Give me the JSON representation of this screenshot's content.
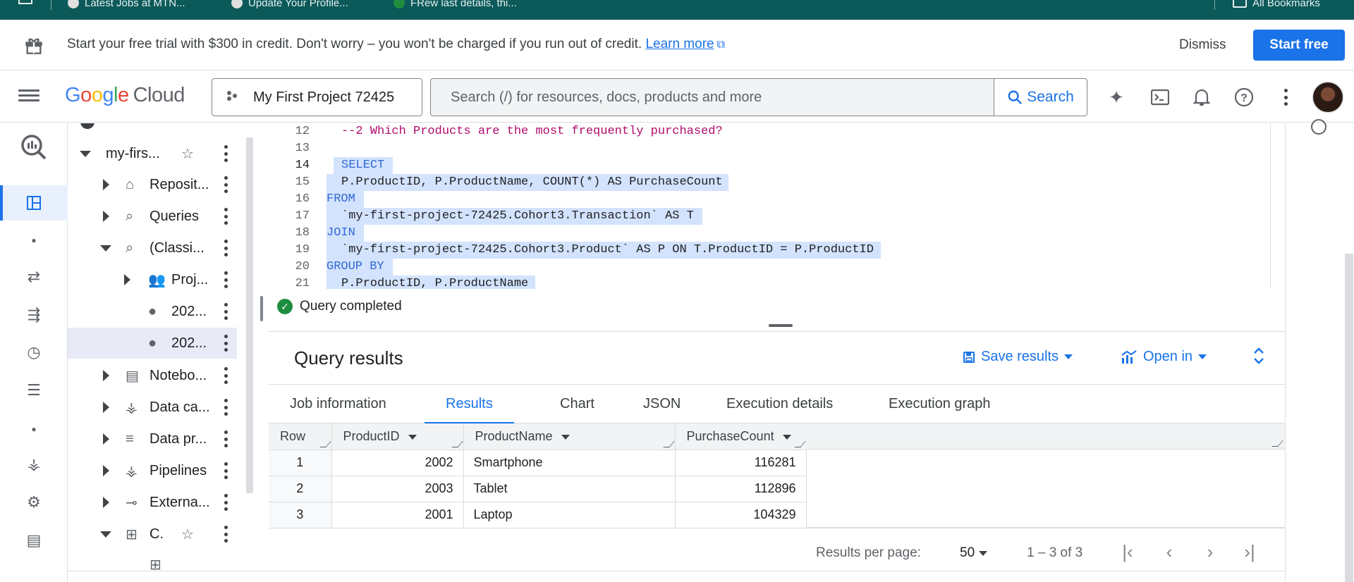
{
  "bookmarks": [
    {
      "label": "Latest Jobs at MTN..."
    },
    {
      "label": "Update Your Profile..."
    },
    {
      "label": "FRew last details, thi..."
    }
  ],
  "bookmarks_all": "All Bookmarks",
  "banner": {
    "message": "Start your free trial with $300 in credit. Don't worry – you won't be charged if you run out of credit.",
    "learn_more": "Learn more",
    "dismiss": "Dismiss",
    "start_free": "Start free"
  },
  "header": {
    "logo_google": "Google",
    "logo_cloud": "Cloud",
    "project": "My First Project 72425",
    "search_placeholder": "Search (/) for resources, docs, products and more",
    "search_button": "Search"
  },
  "tree": [
    {
      "label": "my-firs..."
    },
    {
      "label": "Reposit..."
    },
    {
      "label": "Queries"
    },
    {
      "label": "(Classi..."
    },
    {
      "label": "Proj..."
    },
    {
      "label": "202..."
    },
    {
      "label": "202..."
    },
    {
      "label": "Notebo..."
    },
    {
      "label": "Data ca..."
    },
    {
      "label": "Data pr..."
    },
    {
      "label": "Pipelines"
    },
    {
      "label": "Externa..."
    },
    {
      "label": "C."
    }
  ],
  "editor": {
    "lines": [
      {
        "n": "12",
        "text": "--2 Which Products are the most frequently purchased?"
      },
      {
        "n": "13",
        "text": ""
      },
      {
        "n": "14",
        "text": "SELECT"
      },
      {
        "n": "15",
        "text": "P.ProductID, P.ProductName, COUNT(*) AS PurchaseCount"
      },
      {
        "n": "16",
        "text": "FROM"
      },
      {
        "n": "17",
        "text": "`my-first-project-72425.Cohort3.Transaction` AS T"
      },
      {
        "n": "18",
        "text": "JOIN"
      },
      {
        "n": "19",
        "text": "`my-first-project-72425.Cohort3.Product` AS P ON T.ProductID = P.ProductID"
      },
      {
        "n": "20",
        "text": "GROUP BY"
      },
      {
        "n": "21",
        "text": "P.ProductID, P.ProductName"
      }
    ]
  },
  "status": "Query completed",
  "results": {
    "title": "Query results",
    "save": "Save results",
    "open": "Open in",
    "tabs": [
      "Job information",
      "Results",
      "Chart",
      "JSON",
      "Execution details",
      "Execution graph"
    ],
    "columns": [
      "Row",
      "ProductID",
      "ProductName",
      "PurchaseCount"
    ],
    "rows": [
      {
        "row": "1",
        "id": "2002",
        "name": "Smartphone",
        "count": "116281"
      },
      {
        "row": "2",
        "id": "2003",
        "name": "Tablet",
        "count": "112896"
      },
      {
        "row": "3",
        "id": "2001",
        "name": "Laptop",
        "count": "104329"
      }
    ],
    "pager": {
      "label": "Results per page:",
      "size": "50",
      "range": "1 – 3 of 3"
    }
  },
  "colors": {
    "accent": "#1a73e8",
    "bookmarks_bar": "#0b5959",
    "selection": "#d3e3fd"
  }
}
